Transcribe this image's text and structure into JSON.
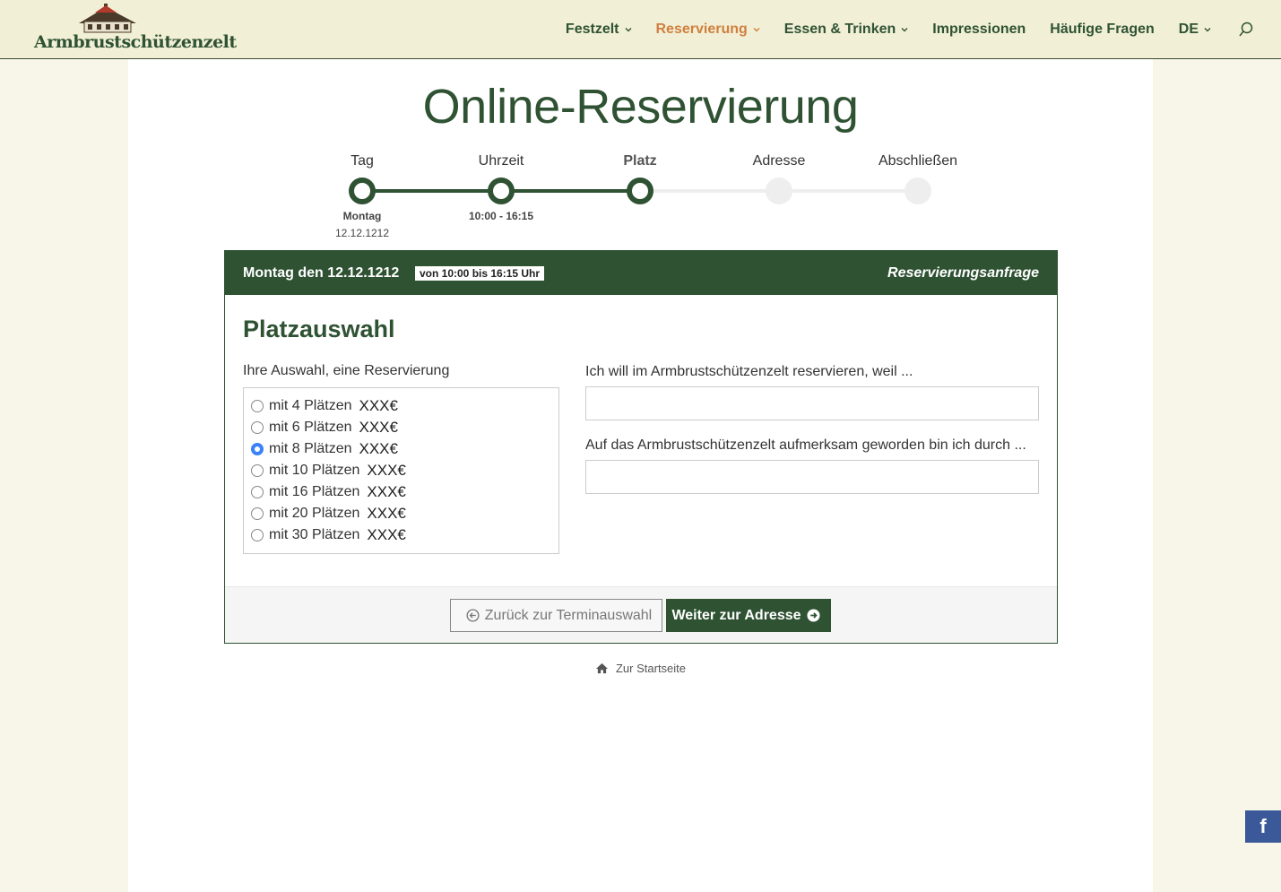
{
  "header": {
    "logo_text": "Armbrustschützenzelt",
    "nav": [
      {
        "label": "Festzelt",
        "dropdown": true,
        "active": false
      },
      {
        "label": "Reservierung",
        "dropdown": true,
        "active": true
      },
      {
        "label": "Essen & Trinken",
        "dropdown": true,
        "active": false
      },
      {
        "label": "Impressionen",
        "dropdown": false,
        "active": false
      },
      {
        "label": "Häufige Fragen",
        "dropdown": false,
        "active": false
      },
      {
        "label": "DE",
        "dropdown": true,
        "active": false
      }
    ],
    "search_icon": "search-icon"
  },
  "page": {
    "title": "Online-Reservierung"
  },
  "stepper": {
    "steps": [
      {
        "label": "Tag",
        "state": "done",
        "sub1": "Montag",
        "sub2": "12.12.1212"
      },
      {
        "label": "Uhrzeit",
        "state": "done",
        "sub1": "10:00 - 16:15",
        "sub2": ""
      },
      {
        "label": "Platz",
        "state": "current",
        "sub1": "",
        "sub2": ""
      },
      {
        "label": "Adresse",
        "state": "todo",
        "sub1": "",
        "sub2": ""
      },
      {
        "label": "Abschließen",
        "state": "todo",
        "sub1": "",
        "sub2": ""
      }
    ]
  },
  "card": {
    "date": "Montag den 12.12.1212",
    "time_badge": "von 10:00 bis 16:15 Uhr",
    "type": "Reservierungsanfrage",
    "title": "Platzauswahl",
    "selection_label": "Ihre Auswahl, eine Reservierung",
    "options": [
      {
        "label": "mit 4 Plätzen",
        "price": "XXX€",
        "selected": false
      },
      {
        "label": "mit 6 Plätzen",
        "price": "XXX€",
        "selected": false
      },
      {
        "label": "mit 8 Plätzen",
        "price": "XXX€",
        "selected": true
      },
      {
        "label": "mit 10 Plätzen",
        "price": "XXX€",
        "selected": false
      },
      {
        "label": "mit 16 Plätzen",
        "price": "XXX€",
        "selected": false
      },
      {
        "label": "mit 20 Plätzen",
        "price": "XXX€",
        "selected": false
      },
      {
        "label": "mit 30 Plätzen",
        "price": "XXX€",
        "selected": false
      }
    ],
    "reason_label": "Ich will im Armbrustschützenzelt reservieren, weil ...",
    "reason_value": "",
    "source_label": "Auf das Armbrustschützenzelt aufmerksam geworden bin ich durch ...",
    "source_value": "",
    "back_button": "Zurück zur Terminauswahl",
    "next_button": "Weiter zur Adresse"
  },
  "footer": {
    "home_link": "Zur Startseite"
  },
  "social": {
    "facebook_glyph": "f"
  },
  "colors": {
    "brand_green": "#2f5233",
    "accent_orange": "#d07f3e",
    "background": "#f7f6e8",
    "radio_selected": "#3b82f6",
    "facebook": "#3b5998"
  }
}
